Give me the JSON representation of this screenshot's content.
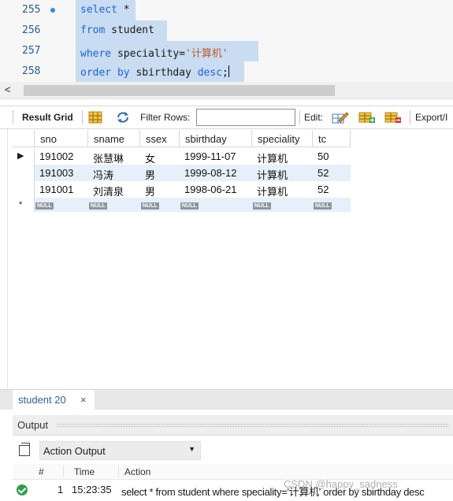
{
  "editor": {
    "lines": [
      {
        "number": "255",
        "parts": [
          {
            "t": "select",
            "c": "kw"
          },
          {
            "t": " *",
            "c": ""
          }
        ],
        "has_marker": true
      },
      {
        "number": "256",
        "parts": [
          {
            "t": "from",
            "c": "kw"
          },
          {
            "t": " student",
            "c": ""
          }
        ],
        "has_marker": false
      },
      {
        "number": "257",
        "parts": [
          {
            "t": "where",
            "c": "kw"
          },
          {
            "t": " speciality=",
            "c": ""
          },
          {
            "t": "'计算机'",
            "c": "str"
          }
        ],
        "has_marker": false
      },
      {
        "number": "258",
        "parts": [
          {
            "t": "order by",
            "c": "kw"
          },
          {
            "t": " sbirthday ",
            "c": ""
          },
          {
            "t": "desc",
            "c": "kw"
          },
          {
            "t": ";",
            "c": ""
          }
        ],
        "has_marker": false
      }
    ],
    "scroll_left_arrow": "<"
  },
  "result_toolbar": {
    "result_grid_label": "Result Grid",
    "filter_rows_label": "Filter Rows:",
    "filter_rows_value": "",
    "edit_label": "Edit:",
    "export_label": "Export/I"
  },
  "grid": {
    "columns": [
      "sno",
      "sname",
      "ssex",
      "sbirthday",
      "speciality",
      "tc"
    ],
    "rows": [
      [
        "191002",
        "张慧琳",
        "女",
        "1999-11-07",
        "计算机",
        "50"
      ],
      [
        "191003",
        "冯涛",
        "男",
        "1999-08-12",
        "计算机",
        "52"
      ],
      [
        "191001",
        "刘清泉",
        "男",
        "1998-06-21",
        "计算机",
        "52"
      ]
    ],
    "null_label": "NULL",
    "current_row_marker": "▶",
    "new_row_marker": "*"
  },
  "result_tabs": [
    {
      "label": "student 20",
      "close": "×"
    }
  ],
  "output": {
    "title": "Output",
    "selector_value": "Action Output",
    "columns": {
      "num": "#",
      "time": "Time",
      "action": "Action"
    },
    "rows": [
      {
        "num": "1",
        "time": "15:23:35",
        "action": "select * from student where speciality='计算机' order by sbirthday desc",
        "status": "success"
      }
    ]
  },
  "watermark": "CSDN @happy_sadness",
  "colors": {
    "keyword": "#1a66d6",
    "string": "#c2582b",
    "selection": "#c9dcf2",
    "success": "#2ea04a",
    "row_alt": "#e6f0fb"
  }
}
